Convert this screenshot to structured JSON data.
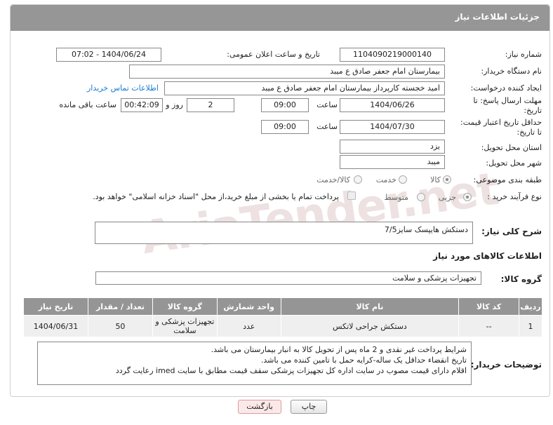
{
  "header": {
    "title": "جزئیات اطلاعات نیاز"
  },
  "watermark": "AriaTender.net",
  "fields": {
    "need_number_label": "شماره نیاز:",
    "need_number": "1104090219000140",
    "announce_label": "تاریخ و ساعت اعلان عمومی:",
    "announce_value": "1404/06/24 - 07:02",
    "buyer_org_label": "نام دستگاه خریدار:",
    "buyer_org": "بیمارستان امام جعفر صادق  ع  میبد",
    "requester_label": "ایجاد کننده درخواست:",
    "requester": "امید خجسته کارپرداز بیمارستان امام جعفر صادق  ع  میبد",
    "contact_link": "اطلاعات تماس خریدار",
    "deadline_label_1": "مهلت ارسال پاسخ: تا",
    "deadline_label_2": "تاریخ:",
    "deadline_date": "1404/06/26",
    "time_label": "ساعت",
    "deadline_time": "09:00",
    "days_value": "2",
    "days_label": "روز و",
    "remaining_time": "00:42:09",
    "remaining_label": "ساعت باقی مانده",
    "validity_label_1": "حداقل تاریخ اعتبار قیمت:",
    "validity_label_2": "تا تاریخ:",
    "validity_date": "1404/07/30",
    "validity_time": "09:00",
    "province_label": "استان محل تحویل:",
    "province": "یزد",
    "city_label": "شهر محل تحویل:",
    "city": "میبد",
    "category_label": "طبقه بندی موضوعی:",
    "category_options": [
      "کالا",
      "خدمت",
      "کالا/خدمت"
    ],
    "process_label": "نوع فرآیند خرید :",
    "process_options": [
      "جزیی",
      "متوسط"
    ],
    "payment_note": "پرداخت تمام یا بخشی از مبلغ خرید،از محل \"اسناد خزانه اسلامی\" خواهد بود."
  },
  "description": {
    "label": "شرح کلی نیاز:",
    "value": "دستکش هایپسک سایز7/5"
  },
  "goods_section": {
    "title": "اطلاعات کالاهای مورد نیاز",
    "group_label": "گروه کالا:",
    "group_value": "تجهیزات پزشکی و سلامت"
  },
  "table": {
    "headers": [
      "ردیف",
      "کد کالا",
      "نام کالا",
      "واحد شمارش",
      "گروه کالا",
      "تعداد / مقدار",
      "تاریخ نیاز"
    ],
    "rows": [
      [
        "1",
        "--",
        "دستکش جراحی لاتکس",
        "عدد",
        "تجهیزات پزشکی و سلامت",
        "50",
        "1404/06/31"
      ]
    ]
  },
  "buyer_notes": {
    "label": "توضیحات خریدار:",
    "lines": [
      "شرایط پرداخت غیر نقدی و 2 ماه  پس از تحویل کالا به انبار بیمارستان می باشد.",
      "تاریخ انقضاء حداقل یک ساله-کرایه حمل با تامین کننده می باشد.",
      "اقلام دارای قیمت مصوب در سایت اداره کل تجهیزات پزشکی سقف قیمت مطابق با سایت imed  رعایت گردد"
    ]
  },
  "buttons": {
    "print": "چاپ",
    "back": "بازگشت"
  }
}
